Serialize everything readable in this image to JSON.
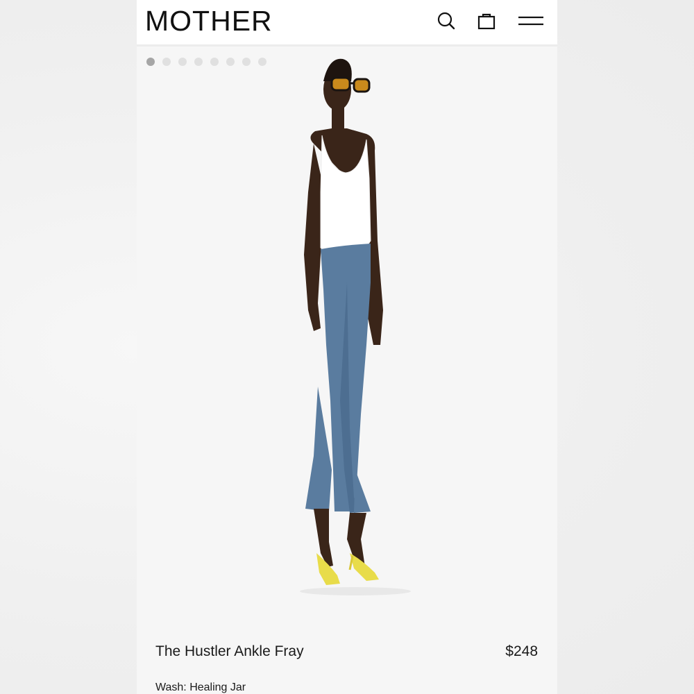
{
  "header": {
    "logo": "MOTHER",
    "search_icon": "search-icon",
    "bag_icon": "shopping-bag-icon",
    "menu_icon": "hamburger-menu-icon"
  },
  "gallery": {
    "image_count": 8,
    "active_index": 0,
    "image_alt": "model wearing jeans"
  },
  "product": {
    "name": "The Hustler Ankle Fray",
    "price": "$248",
    "wash": "Wash: Healing Jar"
  },
  "colors": {
    "header_bg": "#ffffff",
    "page_bg": "#f6f6f6",
    "text": "#1a1a1a",
    "dot_active": "#a6a6a6",
    "dot_inactive": "#e0e0e0",
    "denim": "#5a7c9f",
    "heel_yellow": "#e8dc4a"
  }
}
